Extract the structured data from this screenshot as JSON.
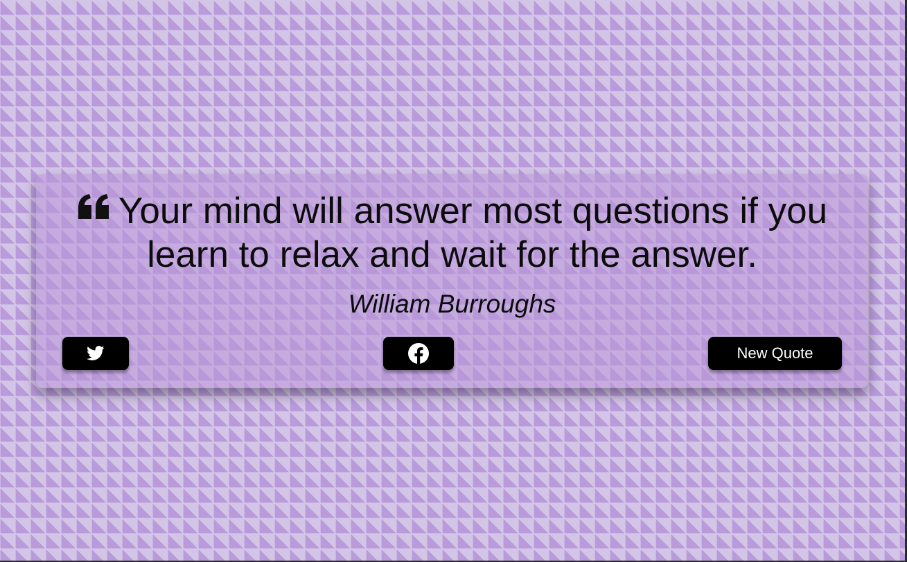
{
  "quote": {
    "text": "Your mind will answer most questions if you learn to relax and wait for the answer.",
    "author": "William Burroughs",
    "icon": "quote-left-icon"
  },
  "buttons": {
    "twitter": {
      "icon": "twitter-icon"
    },
    "facebook": {
      "icon": "facebook-icon"
    },
    "new_quote_label": "New Quote"
  },
  "colors": {
    "card_background": "#b996d7",
    "button_background": "#000000",
    "button_text": "#ffffff",
    "text": "#0c0c0c"
  }
}
